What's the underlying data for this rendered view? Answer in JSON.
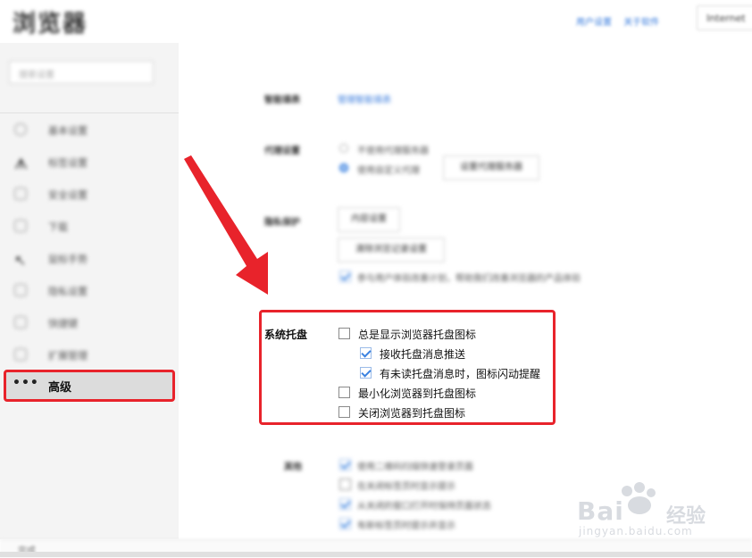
{
  "header": {
    "logo": "浏览器",
    "links": [
      "用户设置",
      "关于软件"
    ],
    "right_button": "Internet"
  },
  "sidebar": {
    "search_placeholder": "搜索设置",
    "items": [
      {
        "label": "基本设置",
        "icon": "circle-icon"
      },
      {
        "label": "标签设置",
        "icon": "tabs-icon"
      },
      {
        "label": "安全设置",
        "icon": "shield-icon"
      },
      {
        "label": "下载",
        "icon": "download-icon"
      },
      {
        "label": "鼠标手势",
        "icon": "mouse-icon"
      },
      {
        "label": "隐私设置",
        "icon": "privacy-icon"
      },
      {
        "label": "快捷键",
        "icon": "keyboard-icon"
      },
      {
        "label": "扩展管理",
        "icon": "extension-icon"
      }
    ],
    "active_item": {
      "label": "高级",
      "icon": "more-dots-icon"
    }
  },
  "content": {
    "row1": {
      "label": "智能填表",
      "value": "管理智能填表"
    },
    "proxy": {
      "label": "代理设置",
      "options": [
        "不使用代理服务器",
        "使用自定义代理"
      ],
      "selected_index": 1,
      "button": "设置代理服务器"
    },
    "privacy": {
      "label": "隐私保护",
      "buttons": [
        "内容设置",
        "清除浏览记录设置"
      ],
      "checkbox": {
        "label": "参与用户体验改善计划，帮助我们改善浏览器的产品体验",
        "checked": true
      }
    },
    "tray": {
      "label": "系统托盘",
      "options": [
        {
          "label": "总是显示浏览器托盘图标",
          "checked": false,
          "indent": false
        },
        {
          "label": "接收托盘消息推送",
          "checked": true,
          "indent": true
        },
        {
          "label": "有未读托盘消息时，图标闪动提醒",
          "checked": true,
          "indent": true
        },
        {
          "label": "最小化浏览器到托盘图标",
          "checked": false,
          "indent": false
        },
        {
          "label": "关闭浏览器到托盘图标",
          "checked": false,
          "indent": false
        }
      ]
    },
    "other": {
      "label": "其他",
      "options": [
        {
          "label": "使用二维码扫描快速登录页面",
          "checked": true
        },
        {
          "label": "在关闭标签页时显示提示",
          "checked": false
        },
        {
          "label": "从关闭的窗口打开时保持页面状态",
          "checked": true
        },
        {
          "label": "有新标签页时提示并显示",
          "checked": true
        }
      ]
    }
  },
  "status_bar": {
    "text": "完成"
  },
  "watermark": {
    "brand": "Bai",
    "brand2": "经验",
    "url": "jingyan.baidu.com"
  },
  "colors": {
    "accent": "#3b82e0",
    "highlight": "#e8232b",
    "sidebar_bg": "#f4f4f4",
    "active_bg": "#dcdcdc"
  }
}
